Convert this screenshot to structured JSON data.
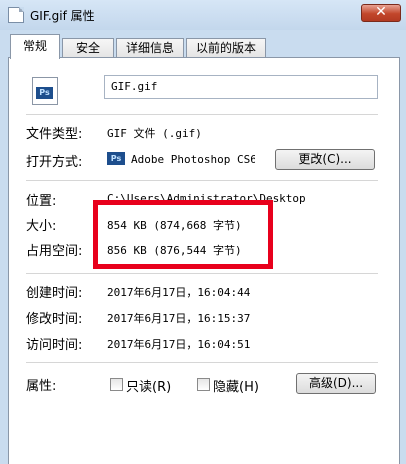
{
  "window": {
    "title": "GIF.gif 属性",
    "close_symbol": "✕"
  },
  "tabs": [
    "常规",
    "安全",
    "详细信息",
    "以前的版本"
  ],
  "file": {
    "name": "GIF.gif",
    "icon_badge": "Ps"
  },
  "labels": {
    "type": "文件类型:",
    "opens_with": "打开方式:",
    "location": "位置:",
    "size": "大小:",
    "size_on_disk": "占用空间:",
    "created": "创建时间:",
    "modified": "修改时间:",
    "accessed": "访问时间:",
    "attributes": "属性:"
  },
  "values": {
    "type": "GIF 文件 (.gif)",
    "opens_with": "Adobe Photoshop CS6",
    "location": "C:\\Users\\Administrator\\Desktop",
    "size": "854 KB (874,668 字节)",
    "size_on_disk": "856 KB (876,544 字节)",
    "created": "2017年6月17日，16:04:44",
    "modified": "2017年6月17日，16:15:37",
    "accessed": "2017年6月17日，16:04:51"
  },
  "buttons": {
    "change": "更改(C)...",
    "advanced": "高级(D)..."
  },
  "attributes": {
    "readonly": "只读(R)",
    "hidden": "隐藏(H)"
  },
  "colors": {
    "highlight": "#e8001c",
    "window_frame": "#c9dcef",
    "close_button": "#c2462b"
  }
}
